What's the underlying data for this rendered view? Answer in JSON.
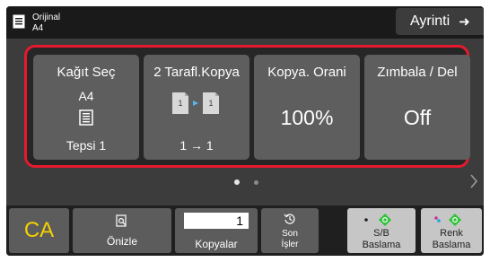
{
  "header": {
    "original_label": "Orijinal",
    "original_size": "A4",
    "details_label": "Ayrinti",
    "details_arrow": "➜"
  },
  "tiles": [
    {
      "title": "Kağıt Seç",
      "sub1": "A4",
      "sub2": "Tepsi 1"
    },
    {
      "title": "2 Tarafl.Kopya",
      "sub2": "1 → 1"
    },
    {
      "title": "Kopya. Orani",
      "big": "100%"
    },
    {
      "title": "Zımbala / Del",
      "big": "Off"
    }
  ],
  "pager": {
    "pages": 2,
    "current": 1
  },
  "bottom": {
    "ca_label": "CA",
    "preview_label": "Önizle",
    "copies_value": "1",
    "copies_label": "Kopyalar",
    "recent_line1": "Son",
    "recent_line2": "İşler",
    "bw_line1": "S/B",
    "bw_line2": "Baslama",
    "color_line1": "Renk",
    "color_line2": "Baslama"
  },
  "icons": {
    "original": "document-icon",
    "tray": "paper-tray-icon",
    "duplex": "duplex-copy-icon",
    "preview": "preview-icon",
    "recent": "history-icon",
    "start": "start-diamond-icon",
    "next": "chevron-right-icon"
  },
  "colors": {
    "selection_border": "#e51a2f",
    "ca_text": "#f5d000",
    "start_green": "#31c23a",
    "color_magenta": "#d12b9c",
    "color_cyan": "#1aa7d8"
  }
}
